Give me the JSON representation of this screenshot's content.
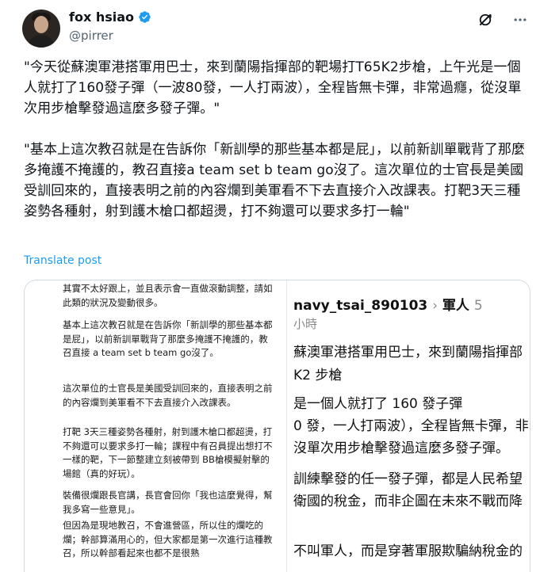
{
  "author": {
    "name": "fox hsiao",
    "handle": "@pirrer",
    "verified_color": "#1d9bf0"
  },
  "tweet": {
    "text": "\"今天從蘇澳軍港搭軍用巴士，來到蘭陽指揮部的靶場打T65K2步槍，上午光是一個人就打了160發子彈（一波80發，一人打兩波），全程皆無卡彈，非常過癮，從沒單次用步槍擊發過這麼多發子彈。\"\n\n\"基本上這次教召就是在告訴你「新訓學的那些基本都是屁」，以前新訓單戰背了那麼多掩護不掩護的，教召直接a team set b team go沒了。這次單位的士官長是美國受訓回來的，直接表明之前的內容爛到美軍看不下去直接介入改課表。打靶3天三種姿勢各種射，射到護木槍口都超燙，打不夠還可以要求多打一輪\"",
    "translate_label": "Translate post"
  },
  "icons": {
    "grok": "grok-icon",
    "more": "more-icon"
  },
  "media_left": {
    "paragraphs": [
      "其實不太好跟上，並且表示會一直做滾動調整，請如此類的狀況及變動很多。",
      "基本上這次教召就是在告訴你「新訓學的那些基本都是屁」，以前新訓單戰背了那麼多掩護不掩護的，教召直接 a team set b team go沒了。",
      "這次單位的士官長是美國受訓回來的，直接表明之前的內容爛到美軍看不下去直接介入改課表。",
      "打靶 3天三種姿勢各種射，射到護木槍口都超燙，打不夠還可以要求多打一輪；課程中有召員提出想打不一樣的靶，下一節整建立刻被帶到 BB槍模擬射擊的場館（真的好玩）。",
      "裝備很爛跟長官講，長官會回你「我也這麼覺得，幫我多寫一些意見」。",
      "但因為是現地教召，不會進營區，所以住的爛吃的爛；幹部算滿用心的，但大家都是第一次進行這種教召，所以幹部看起來也都不是很熟"
    ]
  },
  "media_right": {
    "username": "navy_tsai_890103",
    "separator": "›",
    "tag": "軍人",
    "count": "5",
    "time": "小時",
    "lines": [
      "蘇澳軍港搭軍用巴士，來到蘭陽指揮部",
      "K2 步槍",
      "是一個人就打了 160 發子彈",
      "0 發，一人打兩波），全程皆無卡彈，非",
      "沒單次用步槍擊發過這麼多發子彈。",
      "訓練擊發的任一發子彈，都是人民希望",
      "衛國的稅金，而非企圖在未來不戰而降",
      "不叫軍人，而是穿著軍服欺騙納稅金的"
    ]
  }
}
